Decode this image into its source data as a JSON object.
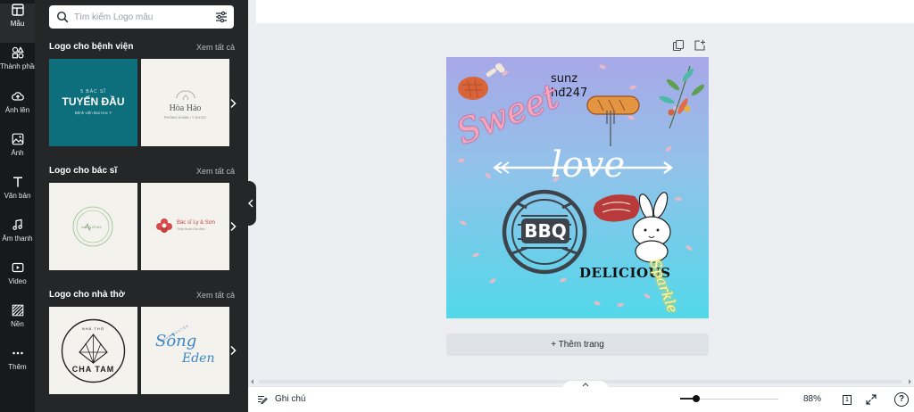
{
  "rail": {
    "items": [
      {
        "label": "Mẫu",
        "icon": "templates-icon"
      },
      {
        "label": "Thành phần",
        "icon": "elements-icon"
      },
      {
        "label": "Ảnh lên",
        "icon": "upload-icon"
      },
      {
        "label": "Ảnh",
        "icon": "photos-icon"
      },
      {
        "label": "Văn bản",
        "icon": "text-icon"
      },
      {
        "label": "Âm thanh",
        "icon": "audio-icon"
      },
      {
        "label": "Video",
        "icon": "video-icon"
      },
      {
        "label": "Nền",
        "icon": "background-icon"
      },
      {
        "label": "Thêm",
        "icon": "more-icon"
      }
    ]
  },
  "search": {
    "placeholder": "Tìm kiếm Logo mẫu"
  },
  "sections": [
    {
      "title": "Logo cho bệnh viện",
      "see_all": "Xem tất cả",
      "thumbs": [
        {
          "line1": "5 BÁC SĨ",
          "line2": "TUYẾN ĐẦU",
          "line3": "Bệnh viện Đại Học Y",
          "bg": "#0e6f7c"
        },
        {
          "line1": "",
          "line2": "Hòa Hảo",
          "line3": "PHÒNG KHÁM • Y DƯỢC",
          "bg": "#f3f2ed"
        }
      ]
    },
    {
      "title": "Logo cho bác sĩ",
      "see_all": "Xem tất cả",
      "thumbs": [
        {
          "line1": "",
          "line2": "BÁC SĨ NHI",
          "line3": "",
          "bg": "#f3f2ed"
        },
        {
          "line1": "",
          "line2": "Bác sĩ Ly & Sơn",
          "line3": "Thấy thuốc Gia đình",
          "bg": "#f3f2ed"
        }
      ]
    },
    {
      "title": "Logo cho nhà thờ",
      "see_all": "Xem tất cả",
      "thumbs": [
        {
          "line1": "NHÀ THỜ",
          "line2": "CHA TAM",
          "line3": "",
          "bg": "#f3f2ed"
        },
        {
          "line1": "NHÀ NGUYỆN",
          "line2": "Sông",
          "line3": "Eden",
          "bg": "#f3f2ed"
        }
      ]
    }
  ],
  "canvas": {
    "text_sunz": "sunz",
    "text_hd": "hđ247",
    "text_sweet": "Sweet",
    "text_love": "love",
    "text_bbq": "BBQ",
    "text_delicious": "DELICIOUS",
    "text_sparkle": "Sparkle"
  },
  "editor": {
    "add_page": "+ Thêm trang"
  },
  "bottom": {
    "notes": "Ghi chú",
    "zoom": "88%",
    "pages": "1"
  }
}
